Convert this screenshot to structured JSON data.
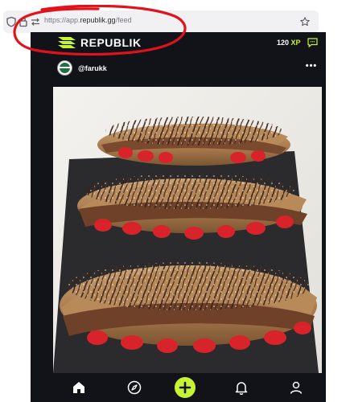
{
  "browser": {
    "url_scheme": "https://app.",
    "url_host": "republik.gg",
    "url_path": "/feed",
    "icons": [
      "shield-icon",
      "lock-icon",
      "swap-icon",
      "bookmark-star-icon"
    ]
  },
  "app": {
    "brand": "REPUBLIK",
    "xp_value": "120",
    "xp_unit": "XP",
    "accent_color": "#c6f432",
    "background_color": "#121219"
  },
  "post": {
    "username": "@farukk",
    "more_label": "•••",
    "image_subject": "strawberry chocolate croissants on slate"
  },
  "nav": {
    "items": [
      "home-icon",
      "explore-compass-icon",
      "add-post-icon",
      "notifications-bell-icon",
      "profile-icon"
    ],
    "active": "home-icon"
  },
  "annotation": {
    "color": "#e0121b"
  }
}
